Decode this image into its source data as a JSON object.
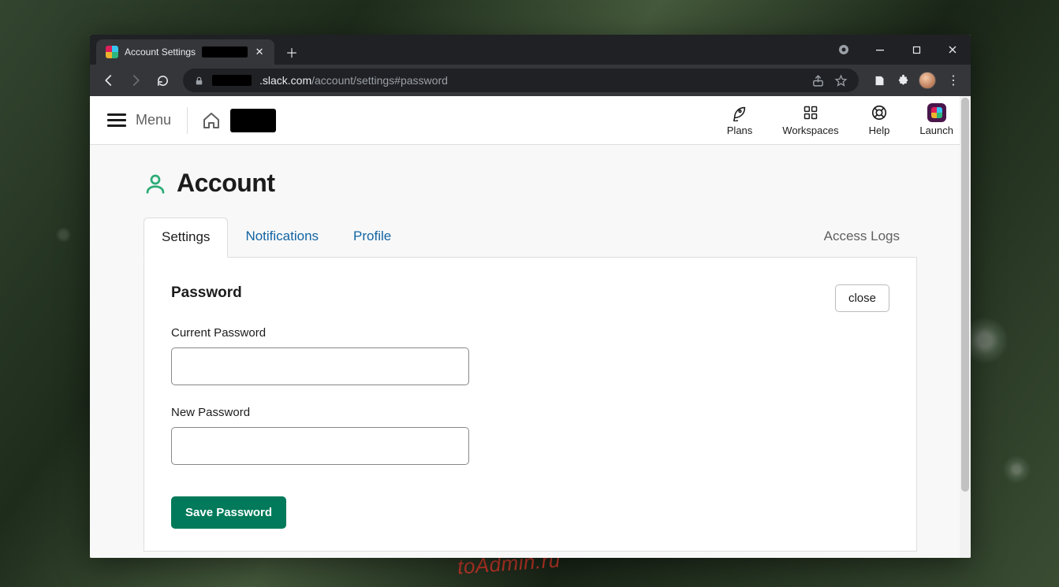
{
  "browser": {
    "tab_title": "Account Settings",
    "url_domain": ".slack.com",
    "url_path": "/account/settings#password"
  },
  "watermark": "toAdmin.ru",
  "header": {
    "menu_label": "Menu",
    "items": [
      {
        "label": "Plans"
      },
      {
        "label": "Workspaces"
      },
      {
        "label": "Help"
      },
      {
        "label": "Launch"
      }
    ]
  },
  "page": {
    "title": "Account",
    "tabs": {
      "settings": "Settings",
      "notifications": "Notifications",
      "profile": "Profile",
      "access_logs": "Access Logs"
    }
  },
  "password_panel": {
    "heading": "Password",
    "close_label": "close",
    "current_label": "Current Password",
    "new_label": "New Password",
    "save_label": "Save Password",
    "current_value": "",
    "new_value": ""
  }
}
